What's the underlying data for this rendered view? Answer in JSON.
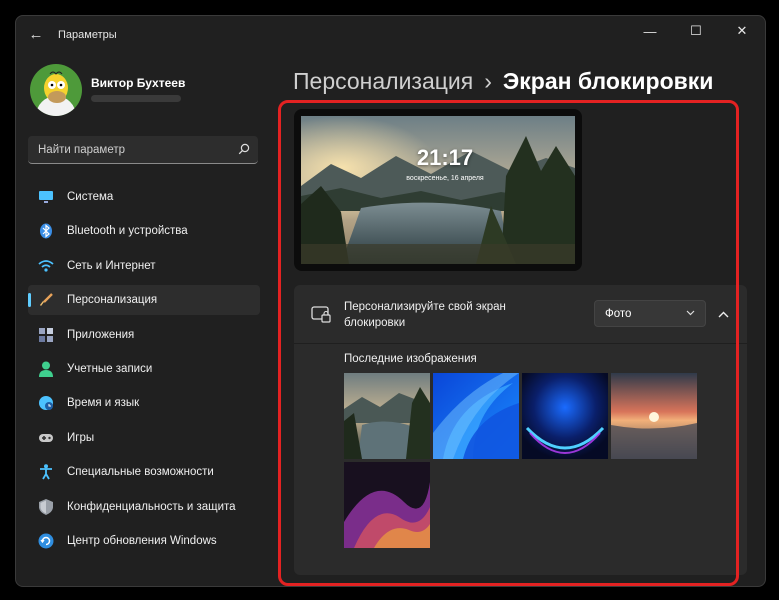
{
  "window": {
    "title": "Параметры",
    "controls": {
      "minimize": "—",
      "maximize": "☐",
      "close": "✕"
    }
  },
  "profile": {
    "name": "Виктор Бухтеев"
  },
  "search": {
    "placeholder": "Найти параметр"
  },
  "sidebar": {
    "items": [
      {
        "label": "Система",
        "icon": "monitor-icon"
      },
      {
        "label": "Bluetooth и устройства",
        "icon": "bluetooth-icon"
      },
      {
        "label": "Сеть и Интернет",
        "icon": "wifi-icon"
      },
      {
        "label": "Персонализация",
        "icon": "brush-icon",
        "active": true
      },
      {
        "label": "Приложения",
        "icon": "apps-icon"
      },
      {
        "label": "Учетные записи",
        "icon": "person-icon"
      },
      {
        "label": "Время и язык",
        "icon": "globe-clock-icon"
      },
      {
        "label": "Игры",
        "icon": "gamepad-icon"
      },
      {
        "label": "Специальные возможности",
        "icon": "accessibility-icon"
      },
      {
        "label": "Конфиденциальность и защита",
        "icon": "shield-icon"
      },
      {
        "label": "Центр обновления Windows",
        "icon": "update-icon"
      }
    ]
  },
  "breadcrumb": {
    "parent": "Персонализация",
    "separator": "›",
    "current": "Экран блокировки"
  },
  "lockscreen_preview": {
    "time": "21:17",
    "date": "воскресенье, 16 апреля"
  },
  "personalize_card": {
    "title": "Персонализируйте свой экран блокировки",
    "dropdown_value": "Фото",
    "recent_images_label": "Последние изображения"
  },
  "colors": {
    "accent": "#60cdff",
    "highlight": "#e32222",
    "background": "#202020",
    "card": "#2b2b2b"
  }
}
